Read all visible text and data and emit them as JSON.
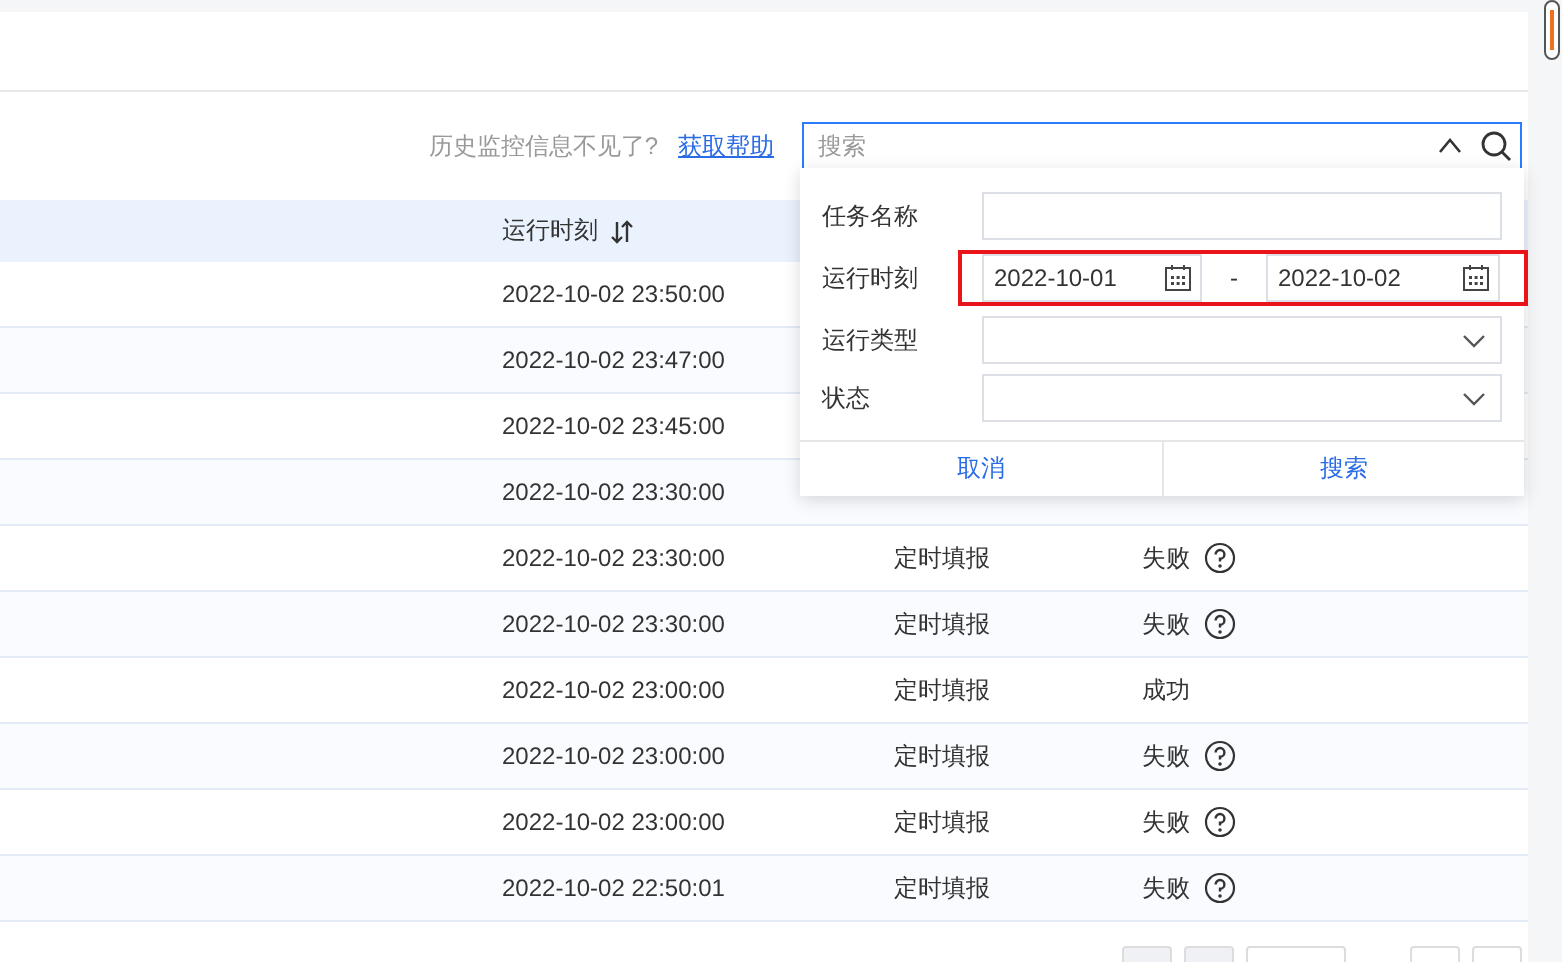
{
  "help": {
    "text": "历史监控信息不见了?",
    "link": "获取帮助"
  },
  "search": {
    "placeholder": "搜索",
    "expanded": true
  },
  "table": {
    "columns": [
      {
        "label": "运行时刻"
      }
    ],
    "rows": [
      {
        "time": "2022-10-02 23:50:00"
      },
      {
        "time": "2022-10-02 23:47:00"
      },
      {
        "time": "2022-10-02 23:45:00"
      },
      {
        "time": "2022-10-02 23:30:00"
      },
      {
        "time": "2022-10-02 23:30:00",
        "type": "定时填报",
        "status": "失败",
        "failed": true
      },
      {
        "time": "2022-10-02 23:30:00",
        "type": "定时填报",
        "status": "失败",
        "failed": true
      },
      {
        "time": "2022-10-02 23:00:00",
        "type": "定时填报",
        "status": "成功",
        "failed": false
      },
      {
        "time": "2022-10-02 23:00:00",
        "type": "定时填报",
        "status": "失败",
        "failed": true
      },
      {
        "time": "2022-10-02 23:00:00",
        "type": "定时填报",
        "status": "失败",
        "failed": true
      },
      {
        "time": "2022-10-02 22:50:01",
        "type": "定时填报",
        "status": "失败",
        "failed": true
      }
    ]
  },
  "filter": {
    "fields": [
      {
        "kind": "text",
        "label": "任务名称"
      },
      {
        "kind": "date_range",
        "label": "运行时刻",
        "from": "2022-10-01",
        "separator": "-",
        "to": "2022-10-02",
        "highlighted": true
      },
      {
        "kind": "select",
        "label": "运行类型"
      },
      {
        "kind": "select",
        "label": "状态"
      }
    ],
    "buttons": [
      "取消",
      "搜索"
    ]
  }
}
